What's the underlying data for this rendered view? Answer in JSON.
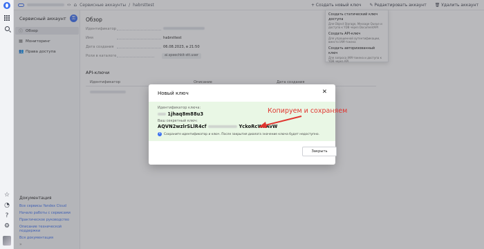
{
  "topbar": {
    "breadcrumb": [
      "Сервисные аккаунты",
      "/",
      "habrsttest"
    ],
    "actions": [
      "Создать новый ключ",
      "Редактировать аккаунт",
      "Удалить аккаунт"
    ]
  },
  "sidebar": {
    "title": "Сервисный аккаунт",
    "items": [
      {
        "label": "Обзор",
        "icon": "info-icon",
        "active": true
      },
      {
        "label": "Мониторинг",
        "icon": "monitoring-icon",
        "active": false
      },
      {
        "label": "Права доступа",
        "icon": "users-icon",
        "active": false
      }
    ],
    "docs_title": "Документация",
    "docs_links": [
      "Все сервисы Yandex Cloud",
      "Начало работы с сервисами",
      "Практическое руководство",
      "Описание технической поддержки",
      "Вся документация"
    ]
  },
  "overview": {
    "heading": "Обзор",
    "fields": [
      {
        "key": "Идентификатор",
        "value": ""
      },
      {
        "key": "Имя",
        "value": "habrsttest"
      },
      {
        "key": "Дата создания",
        "value": "06.08.2023, в 21:50"
      },
      {
        "key": "Роли в каталоге",
        "value": "ai.speechkit-stt.user"
      }
    ]
  },
  "api_keys": {
    "heading": "API-ключи",
    "columns": [
      "Идентификатор",
      "Описание",
      "Дата создания"
    ]
  },
  "create_menu": {
    "items": [
      {
        "title": "Создать статический ключ доступа",
        "desc": "Для Object Storage, Message Queue и доступа к YDB через DocumentAPI"
      },
      {
        "title": "Создать API-ключ",
        "desc": "Для упрощенной аутентификации, вместо IAM-токена"
      },
      {
        "title": "Создать авторизованный ключ",
        "desc": "Для запроса IAM-токена и доступа к YDB через API"
      }
    ]
  },
  "modal": {
    "title": "Новый ключ",
    "id_label": "Идентификатор ключа:",
    "id_value_visible": "1jhaq8m88u3",
    "secret_label": "Ваш секретный ключ:",
    "secret_prefix": "AQVN2wzlrSLlR4cf",
    "secret_suffix": "YckoRcWnAvW",
    "note": "Сохраните идентификатор и ключ. После закрытия диалога значение ключа будет недоступно.",
    "close_label": "Закрыть"
  },
  "annotation": {
    "text": "Копируем и  сохраняем",
    "color": "#e0352f"
  },
  "colors": {
    "accent": "#3a6ff0",
    "success_bg": "#e9f7e5"
  }
}
